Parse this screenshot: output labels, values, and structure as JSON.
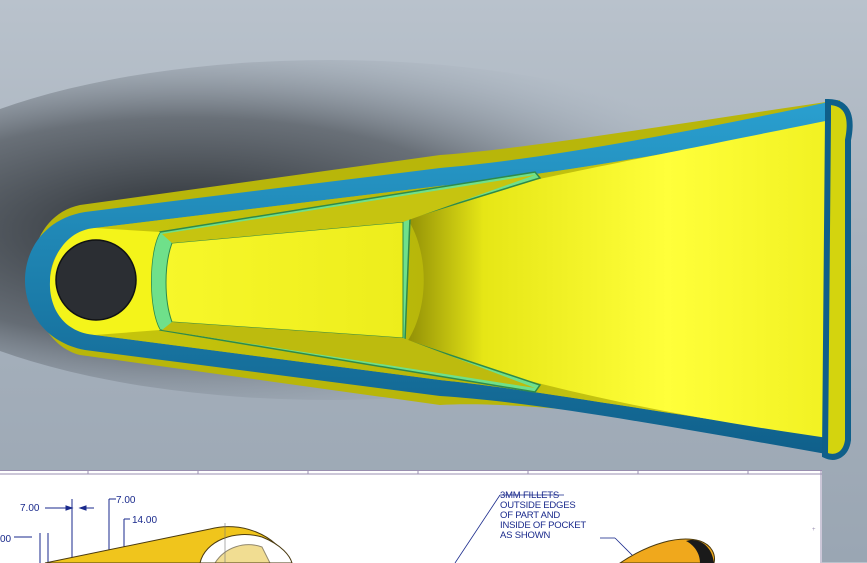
{
  "drawing": {
    "dimensions": {
      "d1": "7.00",
      "d2": "7.00",
      "d3": "14.00",
      "d4": "00"
    },
    "note_lines": [
      "3MM FILLETS",
      "OUTSIDE EDGES",
      "OF PART AND",
      "INSIDE OF POCKET",
      "AS SHOWN"
    ]
  },
  "colors": {
    "part_body": "#f4f41a",
    "fillet_edge": "#1b7fb0",
    "pocket_fillet": "#6fe08a",
    "drawing_ink": "#1a2a8c"
  }
}
